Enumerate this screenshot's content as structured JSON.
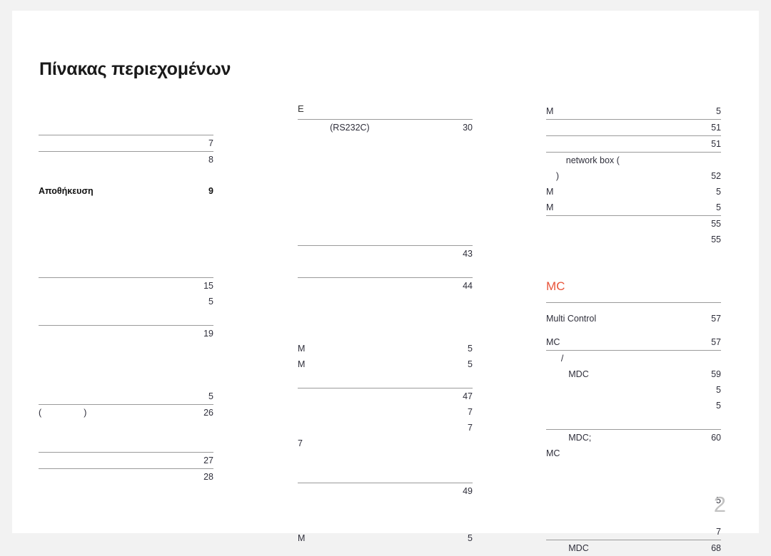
{
  "document": {
    "title": "Πίνακας περιεχομένων",
    "page_number": "2",
    "accent_color": "#e8543a",
    "rule_color": "#9a9a9a"
  },
  "columns": [
    {
      "id": "column-1",
      "blocks": [
        {
          "type": "spacer",
          "size": "s2"
        },
        {
          "type": "rule"
        },
        {
          "type": "entry",
          "label": "",
          "page": "7"
        },
        {
          "type": "rule"
        },
        {
          "type": "entry",
          "label": "",
          "page": "8"
        },
        {
          "type": "spacer",
          "size": "s1"
        },
        {
          "type": "entry",
          "label": "Αποθήκευση",
          "page": "9",
          "bold": true
        },
        {
          "type": "spacer",
          "size": "s5"
        },
        {
          "type": "rule"
        },
        {
          "type": "entry",
          "label": "",
          "page": "15"
        },
        {
          "type": "entry",
          "label": "",
          "page": "5"
        },
        {
          "type": "spacer",
          "size": "s1"
        },
        {
          "type": "rule"
        },
        {
          "type": "entry",
          "label": "",
          "page": "19"
        },
        {
          "type": "spacer",
          "size": "s3"
        },
        {
          "type": "entry",
          "label": "",
          "page": "5"
        },
        {
          "type": "rule"
        },
        {
          "type": "entry",
          "label": "(                 )",
          "page": "26"
        },
        {
          "type": "spacer",
          "size": "s2"
        },
        {
          "type": "rule"
        },
        {
          "type": "entry",
          "label": "",
          "page": "27"
        },
        {
          "type": "rule"
        },
        {
          "type": "entry",
          "label": "",
          "page": "28"
        }
      ]
    },
    {
      "id": "column-2",
      "blocks": [
        {
          "type": "head",
          "label": "E"
        },
        {
          "type": "rule"
        },
        {
          "type": "entry",
          "label": "             (RS232C)",
          "page": "30"
        },
        {
          "type": "spacer",
          "size": "s5"
        },
        {
          "type": "spacer",
          "size": "s2"
        },
        {
          "type": "rule"
        },
        {
          "type": "entry",
          "label": "",
          "page": "43"
        },
        {
          "type": "spacer",
          "size": "s1"
        },
        {
          "type": "rule"
        },
        {
          "type": "entry",
          "label": "",
          "page": "44"
        },
        {
          "type": "spacer",
          "size": "s3"
        },
        {
          "type": "entry",
          "label": "M",
          "page": "5"
        },
        {
          "type": "entry",
          "label": "M",
          "page": "5"
        },
        {
          "type": "spacer",
          "size": "s1"
        },
        {
          "type": "rule"
        },
        {
          "type": "entry",
          "label": "",
          "page": "47"
        },
        {
          "type": "entry",
          "label": "",
          "page": "7"
        },
        {
          "type": "entry",
          "label": "",
          "page": "7"
        },
        {
          "type": "entry",
          "label": "7",
          "page": ""
        },
        {
          "type": "spacer",
          "size": "s2"
        },
        {
          "type": "rule"
        },
        {
          "type": "entry",
          "label": "",
          "page": "49"
        },
        {
          "type": "spacer",
          "size": "s2"
        },
        {
          "type": "entry",
          "label": "M",
          "page": "5"
        }
      ]
    },
    {
      "id": "column-3",
      "blocks": [
        {
          "type": "entry",
          "label": "M",
          "page": "5"
        },
        {
          "type": "rule"
        },
        {
          "type": "entry",
          "label": "",
          "page": "51"
        },
        {
          "type": "rule"
        },
        {
          "type": "entry",
          "label": "",
          "page": "51"
        },
        {
          "type": "rule"
        },
        {
          "type": "entry",
          "label": "        network box (",
          "page": ""
        },
        {
          "type": "entry",
          "label": "    )",
          "page": "52"
        },
        {
          "type": "entry",
          "label": "M",
          "page": "5"
        },
        {
          "type": "entry",
          "label": "M",
          "page": "5"
        },
        {
          "type": "rule"
        },
        {
          "type": "entry",
          "label": "",
          "page": "55"
        },
        {
          "type": "entry",
          "label": "",
          "page": "55"
        },
        {
          "type": "spacer",
          "size": "s2"
        },
        {
          "type": "head",
          "label": "MC",
          "accent": true
        },
        {
          "type": "spacer",
          "size": "h"
        },
        {
          "type": "rule"
        },
        {
          "type": "spacer",
          "size": "h"
        },
        {
          "type": "entry",
          "label": "Multi Control",
          "page": "57"
        },
        {
          "type": "spacer",
          "size": "h"
        },
        {
          "type": "entry",
          "label": "MC",
          "page": "57"
        },
        {
          "type": "rule"
        },
        {
          "type": "entry",
          "label": "      /",
          "page": ""
        },
        {
          "type": "entry",
          "label": "         MDC",
          "page": "59"
        },
        {
          "type": "entry",
          "label": "",
          "page": "5"
        },
        {
          "type": "entry",
          "label": "",
          "page": "5"
        },
        {
          "type": "spacer",
          "size": "s1"
        },
        {
          "type": "rule"
        },
        {
          "type": "entry",
          "label": "         MDC;",
          "page": "60"
        },
        {
          "type": "entry",
          "label": "MC",
          "page": ""
        },
        {
          "type": "spacer",
          "size": "s2"
        },
        {
          "type": "entry",
          "label": "",
          "page": "5"
        },
        {
          "type": "spacer",
          "size": "s1"
        },
        {
          "type": "entry",
          "label": "",
          "page": "7"
        },
        {
          "type": "rule"
        },
        {
          "type": "entry",
          "label": "         MDC",
          "page": "68"
        }
      ]
    }
  ]
}
